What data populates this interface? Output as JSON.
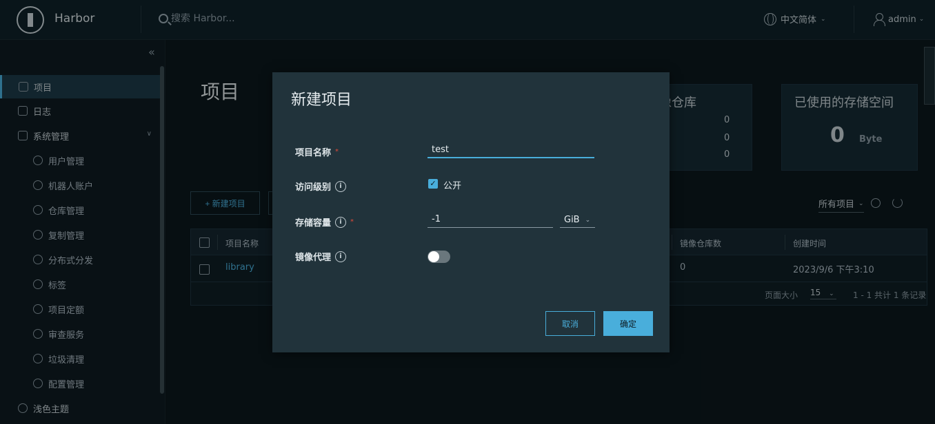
{
  "app": {
    "brand": "Harbor"
  },
  "header": {
    "search_placeholder": "搜索 Harbor...",
    "language": "中文简体",
    "user": "admin"
  },
  "sidebar": {
    "collapse_label": "«",
    "items": [
      {
        "label": "项目",
        "active": true
      },
      {
        "label": "日志"
      },
      {
        "label": "系统管理",
        "expanded": true
      },
      {
        "label": "用户管理"
      },
      {
        "label": "机器人账户"
      },
      {
        "label": "仓库管理"
      },
      {
        "label": "复制管理"
      },
      {
        "label": "分布式分发"
      },
      {
        "label": "标签"
      },
      {
        "label": "项目定额"
      },
      {
        "label": "审查服务"
      },
      {
        "label": "垃圾清理"
      },
      {
        "label": "配置管理"
      },
      {
        "label": "浅色主题"
      }
    ]
  },
  "main": {
    "title": "项目",
    "repo_card": {
      "title": "像仓库",
      "values": [
        "0",
        "0",
        "0"
      ]
    },
    "storage_card": {
      "title": "已使用的存储空间",
      "value": "0",
      "unit": "Byte"
    },
    "new_button": "+ 新建项目",
    "filter": "所有项目",
    "table": {
      "headers": [
        "项目名称",
        "镜像仓库数",
        "创建时间"
      ],
      "rows": [
        {
          "name": "library",
          "repo_count": "0",
          "created": "2023/9/6 下午3:10"
        }
      ],
      "page_size_label": "页面大小",
      "page_size": "15",
      "summary": "1 - 1 共计 1 条记录"
    }
  },
  "modal": {
    "title": "新建项目",
    "name_label": "项目名称",
    "name_value": "test",
    "access_label": "访问级别",
    "access_option": "公开",
    "access_checked": true,
    "capacity_label": "存储容量",
    "capacity_value": "-1",
    "capacity_unit": "GiB",
    "proxy_label": "镜像代理",
    "proxy_enabled": false,
    "required_mark": "*",
    "cancel": "取消",
    "ok": "确定"
  }
}
